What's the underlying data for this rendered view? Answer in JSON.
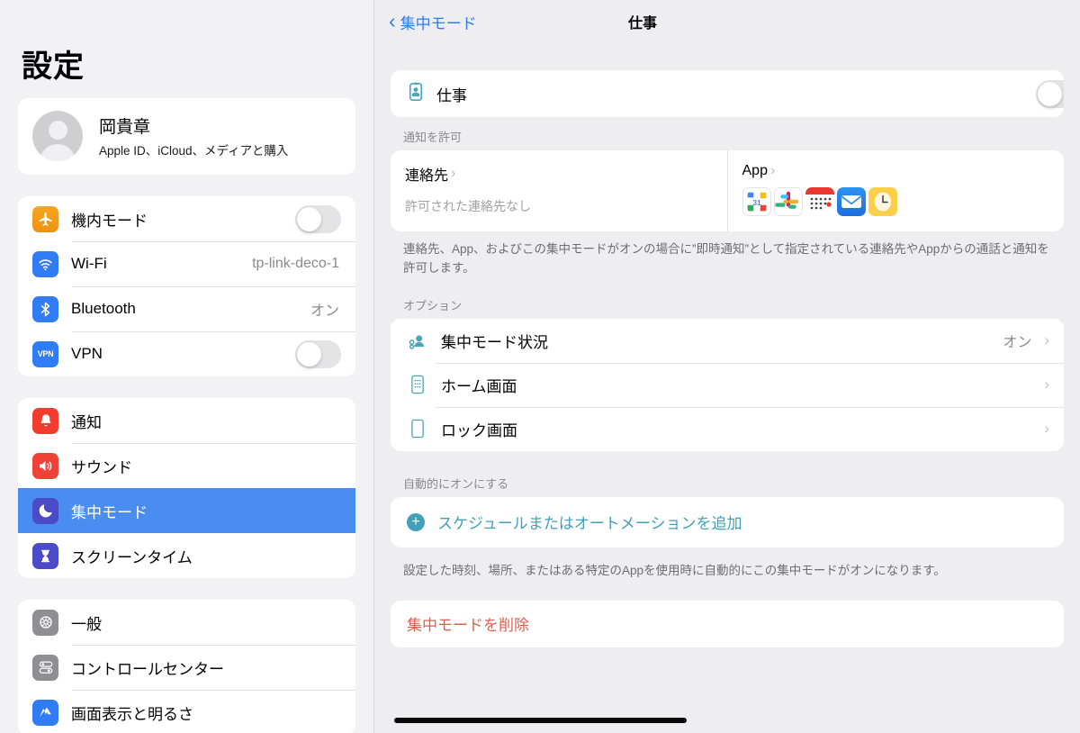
{
  "sidebar": {
    "title": "設定",
    "account": {
      "name": "岡貴章",
      "subtitle": "Apple ID、iCloud、メディアと購入",
      "avatar_icon": "person-avatar"
    },
    "groups": [
      {
        "items": [
          {
            "label": "機内モード",
            "icon": "airplane-icon",
            "control": "toggle",
            "value": "",
            "toggle_on": false
          },
          {
            "label": "Wi-Fi",
            "icon": "wifi-icon",
            "control": "value",
            "value": "tp-link-deco-1"
          },
          {
            "label": "Bluetooth",
            "icon": "bluetooth-icon",
            "control": "value",
            "value": "オン"
          },
          {
            "label": "VPN",
            "icon": "vpn-icon",
            "control": "toggle",
            "value": "",
            "toggle_on": false
          }
        ]
      },
      {
        "items": [
          {
            "label": "通知",
            "icon": "bell-icon",
            "control": "none",
            "value": ""
          },
          {
            "label": "サウンド",
            "icon": "speaker-icon",
            "control": "none",
            "value": ""
          },
          {
            "label": "集中モード",
            "icon": "moon-icon",
            "control": "none",
            "value": "",
            "selected": true
          },
          {
            "label": "スクリーンタイム",
            "icon": "hourglass-icon",
            "control": "none",
            "value": ""
          }
        ]
      },
      {
        "items": [
          {
            "label": "一般",
            "icon": "gear-icon",
            "control": "none",
            "value": ""
          },
          {
            "label": "コントロールセンター",
            "icon": "control-center-icon",
            "control": "none",
            "value": ""
          },
          {
            "label": "画面表示と明るさ",
            "icon": "display-brightness-icon",
            "control": "none",
            "value": ""
          }
        ]
      }
    ]
  },
  "detail": {
    "back_label": "集中モード",
    "title": "仕事",
    "focus": {
      "name": "仕事",
      "icon": "person-badge-icon",
      "toggle_on": false
    },
    "allow_notifications": {
      "group_label": "通知を許可",
      "contacts": {
        "title": "連絡先",
        "subtitle": "許可された連絡先なし"
      },
      "apps": {
        "title": "App",
        "icons": [
          {
            "name": "google-calendar-icon",
            "label": "31"
          },
          {
            "name": "slack-icon",
            "label": ""
          },
          {
            "name": "calendar-grid-icon",
            "label": ""
          },
          {
            "name": "mail-icon",
            "label": ""
          },
          {
            "name": "clock-icon",
            "label": ""
          }
        ]
      },
      "footnote": "連絡先、App、およびこの集中モードがオンの場合に”即時通知”として指定されている連絡先やAppからの通話と通知を許可します。"
    },
    "options": {
      "group_label": "オプション",
      "rows": [
        {
          "label": "集中モード状況",
          "icon": "focus-status-icon",
          "value": "オン"
        },
        {
          "label": "ホーム画面",
          "icon": "home-screen-icon",
          "value": ""
        },
        {
          "label": "ロック画面",
          "icon": "lock-screen-icon",
          "value": ""
        }
      ]
    },
    "automation": {
      "group_label": "自動的にオンにする",
      "add_label": "スケジュールまたはオートメーションを追加",
      "add_icon": "plus-circle-icon",
      "footnote": "設定した時刻、場所、またはある特定のAppを使用時に自動的にこの集中モードがオンになります。"
    },
    "delete": {
      "label": "集中モードを削除"
    }
  },
  "colors": {
    "accent_blue": "#2f7cf6",
    "selection_blue": "#4a8df0",
    "teal": "#42a0bb",
    "destructive_red": "#d9604f",
    "sidebar_bg": "#f2f2f5",
    "detail_bg": "#eeeef0"
  }
}
